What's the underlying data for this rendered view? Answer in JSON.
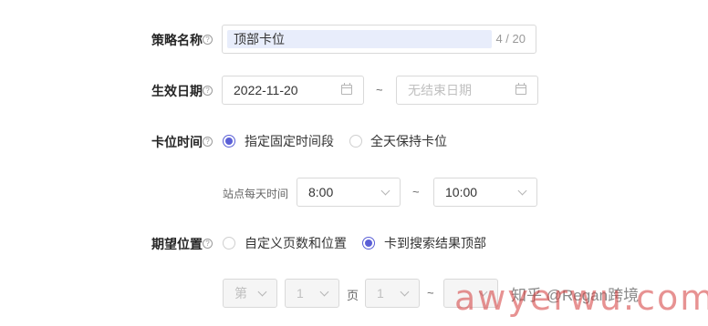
{
  "strategy_name": {
    "label": "策略名称",
    "value": "顶部卡位",
    "counter": "4 / 20"
  },
  "effective_date": {
    "label": "生效日期",
    "start": "2022-11-20",
    "range_sep": "~",
    "end_placeholder": "无结束日期"
  },
  "slot_time": {
    "label": "卡位时间",
    "options": [
      {
        "label": "指定固定时间段",
        "selected": true
      },
      {
        "label": "全天保持卡位",
        "selected": false
      }
    ],
    "daily_time_label": "站点每天时间",
    "start_time": "8:00",
    "range_sep": "~",
    "end_time": "10:00"
  },
  "desired_position": {
    "label": "期望位置",
    "options": [
      {
        "label": "自定义页数和位置",
        "selected": false
      },
      {
        "label": "卡到搜索结果顶部",
        "selected": true
      }
    ],
    "disabled_row": {
      "prefix": "第",
      "page_value": "1",
      "page_unit": "页",
      "pos_value": "1",
      "range_sep": "~"
    }
  },
  "help_glyph": "?",
  "watermark": {
    "text1": "知乎 @Regan跨境",
    "text2": "awyerwu.com"
  },
  "colors": {
    "accent": "#5a5fd6",
    "input_highlight": "#e8edfb",
    "watermark_red": "#d43a3a"
  }
}
